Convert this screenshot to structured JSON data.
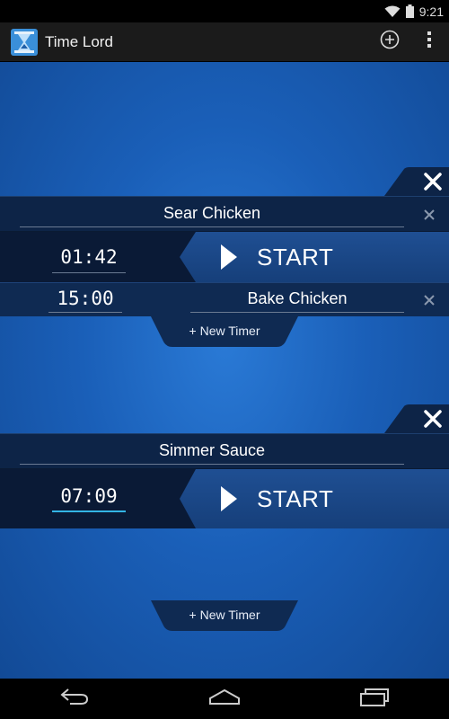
{
  "status_bar": {
    "time": "9:21"
  },
  "app": {
    "title": "Time Lord"
  },
  "timer_groups": [
    {
      "primary": {
        "name": "Sear Chicken",
        "time": "01:42",
        "start_label": "START"
      },
      "secondary": {
        "time": "15:00",
        "name": "Bake Chicken"
      },
      "new_timer_label": "+ New Timer"
    },
    {
      "primary": {
        "name": "Simmer Sauce",
        "time": "07:09",
        "start_label": "START"
      },
      "new_timer_label": "+ New Timer"
    }
  ],
  "icons": {
    "app": "hourglass-icon",
    "add": "add-circle-icon",
    "overflow": "overflow-menu-icon",
    "close": "close-icon",
    "play": "play-icon",
    "nav_back": "back-icon",
    "nav_home": "home-icon",
    "nav_recents": "recents-icon"
  },
  "colors": {
    "accent": "#33b5e5",
    "background_blue": "#1a5fb8",
    "row_dark": "#0a1a36"
  }
}
